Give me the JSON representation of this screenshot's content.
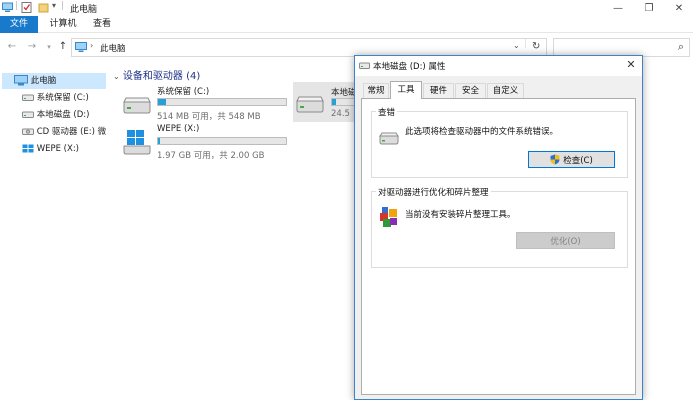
{
  "window": {
    "title": "此电脑",
    "controls": [
      "minimize",
      "maximize",
      "close"
    ]
  },
  "ribbon": {
    "tabs": [
      "文件",
      "计算机",
      "查看"
    ]
  },
  "address": {
    "path": "此电脑"
  },
  "sidebar": {
    "items": [
      {
        "label": "此电脑",
        "icon": "computer-icon",
        "selected": true
      },
      {
        "label": "系统保留 (C:)",
        "icon": "drive-icon"
      },
      {
        "label": "本地磁盘 (D:)",
        "icon": "drive-icon"
      },
      {
        "label": "CD 驱动器 (E:) 微P",
        "icon": "cd-drive-icon"
      },
      {
        "label": "WEPE (X:)",
        "icon": "windows-drive-icon"
      }
    ]
  },
  "content": {
    "group_header": "设备和驱动器 (4)",
    "drives": [
      {
        "name": "系统保留 (C:)",
        "info": "514 MB 可用，共 548 MB",
        "used_fraction": 0.06,
        "icon": "drive-icon"
      },
      {
        "name": "WEPE (X:)",
        "info": "1.97 GB 可用，共 2.00 GB",
        "used_fraction": 0.015,
        "icon": "windows-drive-icon"
      },
      {
        "name": "本地磁盘",
        "info": "24.5",
        "used_fraction": 0.1,
        "icon": "drive-icon",
        "selected": true
      }
    ]
  },
  "dialog": {
    "title": "本地磁盘 (D:) 属性",
    "tabs": [
      "常规",
      "工具",
      "硬件",
      "安全",
      "自定义"
    ],
    "active_tab": "工具",
    "check_section": {
      "legend": "查错",
      "description": "此选项将检查驱动器中的文件系统错误。",
      "button": "检查(C)"
    },
    "optimize_section": {
      "legend": "对驱动器进行优化和碎片整理",
      "description": "当前没有安装碎片整理工具。",
      "button": "优化(O)"
    }
  },
  "colors": {
    "accent": "#1979ca",
    "selection": "#cce8ff",
    "progress": "#26a0da",
    "header": "#1e3287"
  }
}
